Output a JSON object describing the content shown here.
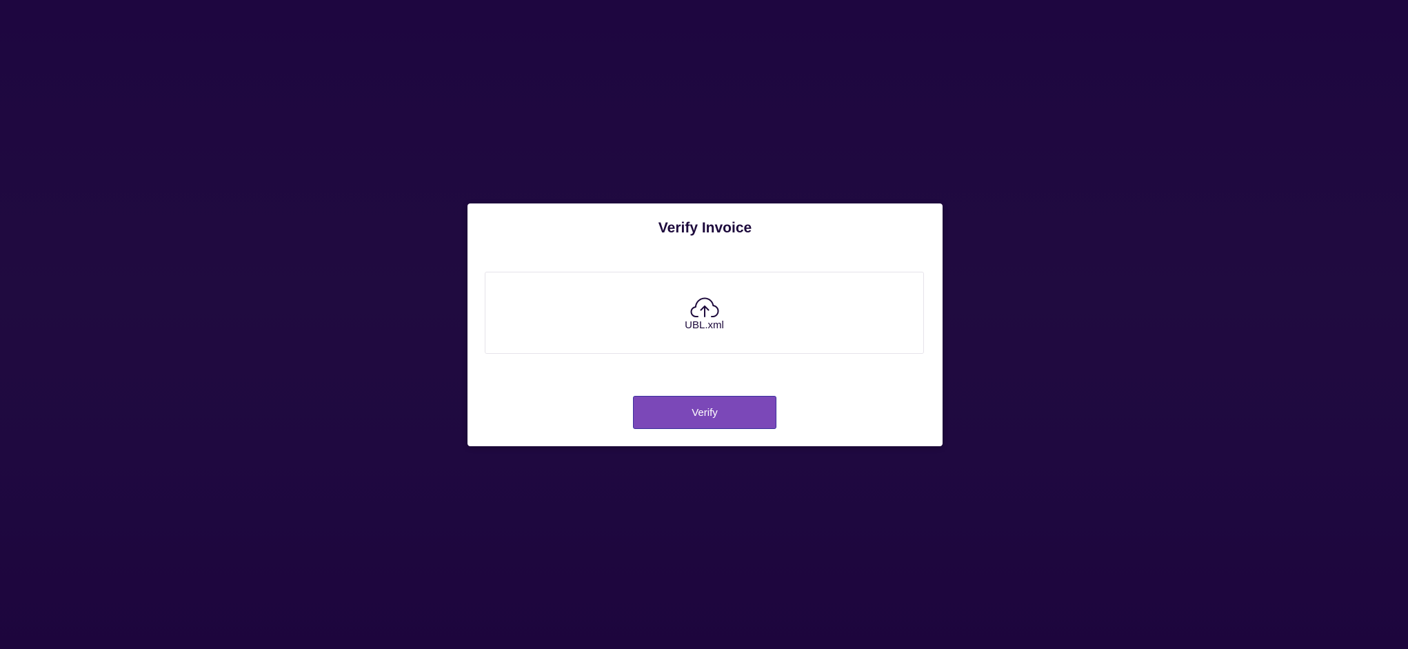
{
  "dialog": {
    "title": "Verify Invoice",
    "upload": {
      "icon": "cloud-upload-icon",
      "filename": "UBL.xml"
    },
    "verify_label": "Verify"
  },
  "colors": {
    "background": "#1e0640",
    "card": "#ffffff",
    "text": "#1d0a3c",
    "button": "#7b48b8",
    "button_border": "#3a2f9e"
  }
}
